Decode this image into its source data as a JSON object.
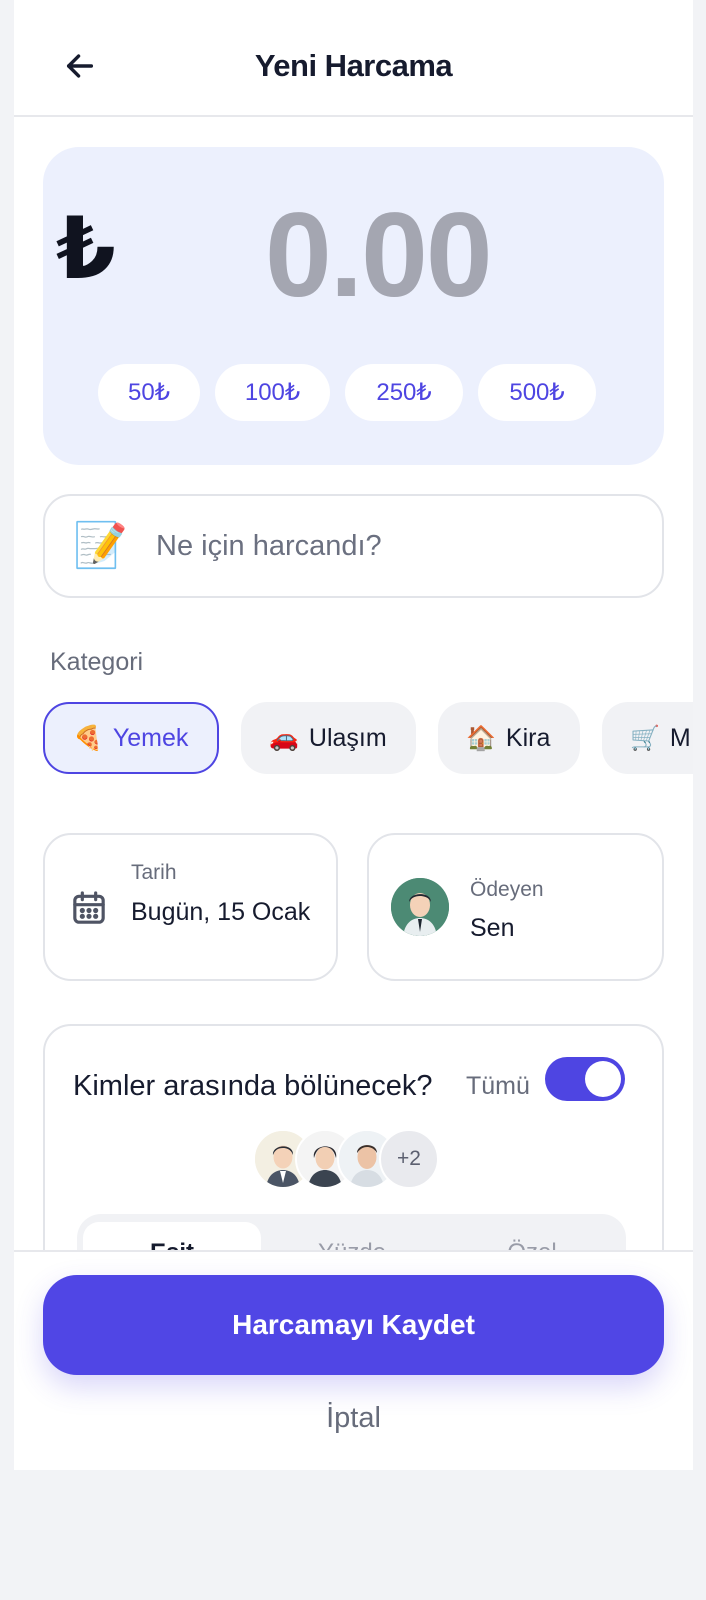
{
  "header": {
    "title": "Yeni Harcama",
    "back_icon": "arrow-left-icon"
  },
  "amount": {
    "currency_symbol": "₺",
    "value": "0.00",
    "quick_amounts": [
      "50₺",
      "100₺",
      "250₺",
      "500₺"
    ]
  },
  "description": {
    "emoji": "📝",
    "placeholder": "Ne için harcandı?",
    "value": ""
  },
  "category": {
    "label": "Kategori",
    "selected": "Yemek",
    "items": [
      {
        "emoji": "🍕",
        "label": "Yemek"
      },
      {
        "emoji": "🚗",
        "label": "Ulaşım"
      },
      {
        "emoji": "🏠",
        "label": "Kira"
      },
      {
        "emoji": "🛒",
        "label": "M"
      }
    ]
  },
  "date": {
    "label": "Tarih",
    "value": "Bugün, 15 Ocak",
    "icon": "calendar-icon"
  },
  "payer": {
    "label": "Ödeyen",
    "value": "Sen"
  },
  "split": {
    "title": "Kimler arasında bölünecek?",
    "all_label": "Tümü",
    "all_enabled": true,
    "extra_count": "+2",
    "tabs": [
      "Eşit",
      "Yüzde",
      "Özel"
    ],
    "active_tab": "Eşit"
  },
  "actions": {
    "save_label": "Harcamayı Kaydet",
    "cancel_label": "İptal"
  },
  "colors": {
    "accent": "#5046e5",
    "card_bg": "#ecf0fd",
    "muted": "#676c7b"
  }
}
